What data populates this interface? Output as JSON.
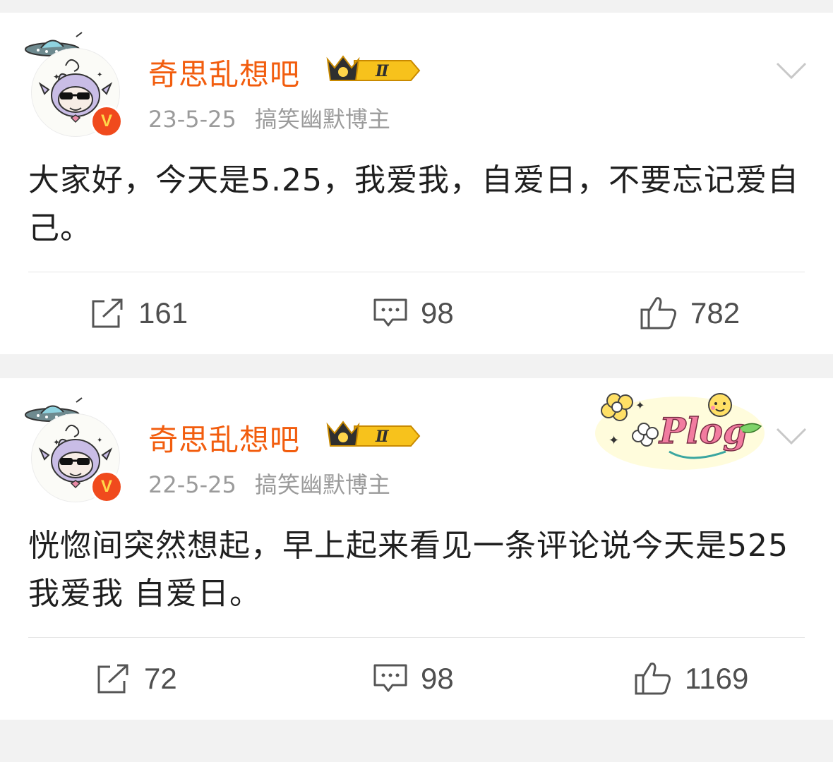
{
  "posts": [
    {
      "username": "奇思乱想吧",
      "level": "Ⅱ",
      "date": "23-5-25",
      "category": "搞笑幽默博主",
      "text": "大家好，今天是5.25，我爱我，自爱日，不要忘记爱自己。",
      "reposts": "161",
      "comments": "98",
      "likes": "782",
      "verified_mark": "V"
    },
    {
      "username": "奇思乱想吧",
      "level": "Ⅱ",
      "date": "22-5-25",
      "category": "搞笑幽默博主",
      "text": "恍惚间突然想起，早上起来看见一条评论说今天是525 我爱我 自爱日。",
      "reposts": "72",
      "comments": "98",
      "likes": "1169",
      "verified_mark": "V",
      "sticker": "Plog"
    }
  ],
  "colors": {
    "username": "#f25d0e",
    "meta": "#9b9b9b",
    "text": "#1f1f1f",
    "action": "#4f4f4f",
    "verified": "#f04a1d"
  },
  "icons": {
    "repost": "repost-icon",
    "comment": "comment-icon",
    "like": "thumbs-up-icon",
    "more": "chevron-down-icon",
    "crown": "crown-icon",
    "verified": "verified-icon"
  }
}
